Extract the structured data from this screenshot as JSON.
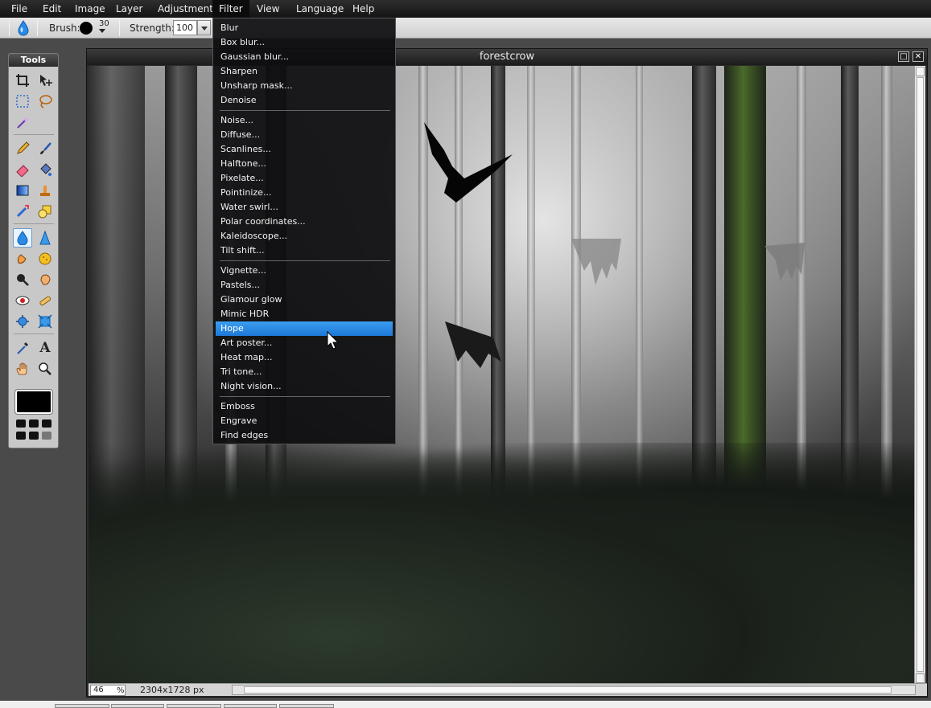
{
  "menubar": {
    "items": [
      {
        "label": "File"
      },
      {
        "label": "Edit"
      },
      {
        "label": "Image"
      },
      {
        "label": "Layer"
      },
      {
        "label": "Adjustment"
      },
      {
        "label": "Filter"
      },
      {
        "label": "View"
      },
      {
        "label": "Language"
      },
      {
        "label": "Help"
      }
    ],
    "open_menu": "Filter"
  },
  "options_bar": {
    "active_tool_icon": "water-drop-icon",
    "brush_label": "Brush:",
    "brush_size": "30",
    "strength_label": "Strength:",
    "strength_value": "100"
  },
  "tools_panel": {
    "title": "Tools",
    "active_tool": "blur-tool",
    "foreground_color": "#000000"
  },
  "image_window": {
    "title": "forestcrow",
    "zoom_value": "46",
    "zoom_unit": "%",
    "image_size": "2304x1728 px"
  },
  "filter_menu": {
    "groups": [
      [
        "Blur",
        "Box blur...",
        "Gaussian blur...",
        "Sharpen",
        "Unsharp mask...",
        "Denoise"
      ],
      [
        "Noise...",
        "Diffuse...",
        "Scanlines...",
        "Halftone...",
        "Pixelate...",
        "Pointinize...",
        "Water swirl...",
        "Polar coordinates...",
        "Kaleidoscope...",
        "Tilt shift..."
      ],
      [
        "Vignette...",
        "Pastels...",
        "Glamour glow",
        "Mimic HDR",
        "Hope",
        "Art poster...",
        "Heat map...",
        "Tri tone...",
        "Night vision..."
      ],
      [
        "Emboss",
        "Engrave",
        "Find edges"
      ]
    ],
    "highlighted": "Hope"
  },
  "colors": {
    "menu_highlight": "#1e78d6",
    "menubar_bg": "#141414",
    "panel_bg": "#c8c8c8"
  }
}
